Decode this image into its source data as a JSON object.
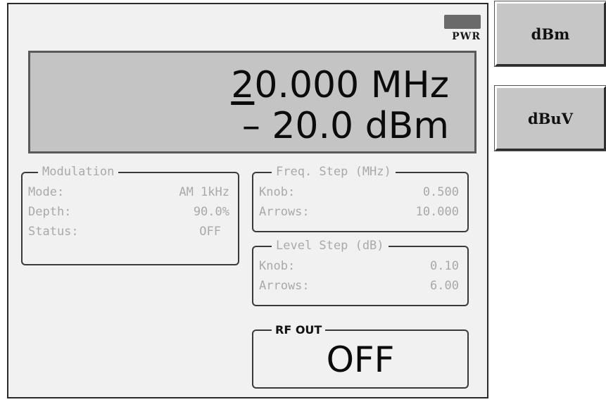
{
  "indicator": {
    "pwr_label": "PWR"
  },
  "display": {
    "freq_cursor_digit": "2",
    "freq_rest": "0.000 MHz",
    "level": "– 20.0 dBm"
  },
  "modulation": {
    "title": "Modulation",
    "rows": [
      {
        "label": "Mode:",
        "value": "AM 1kHz"
      },
      {
        "label": "Depth:",
        "value": "90.0%"
      },
      {
        "label": "Status:",
        "value": "OFF"
      }
    ]
  },
  "freq_step": {
    "title": "Freq. Step (MHz)",
    "rows": [
      {
        "label": "Knob:",
        "value": "0.500"
      },
      {
        "label": "Arrows:",
        "value": "10.000"
      }
    ]
  },
  "level_step": {
    "title": "Level Step (dB)",
    "rows": [
      {
        "label": "Knob:",
        "value": "0.10"
      },
      {
        "label": "Arrows:",
        "value": "6.00"
      }
    ]
  },
  "rf_out": {
    "title": "RF OUT",
    "state": "OFF"
  },
  "softkeys": [
    {
      "label": "dBm"
    },
    {
      "label": "dBuV"
    }
  ]
}
